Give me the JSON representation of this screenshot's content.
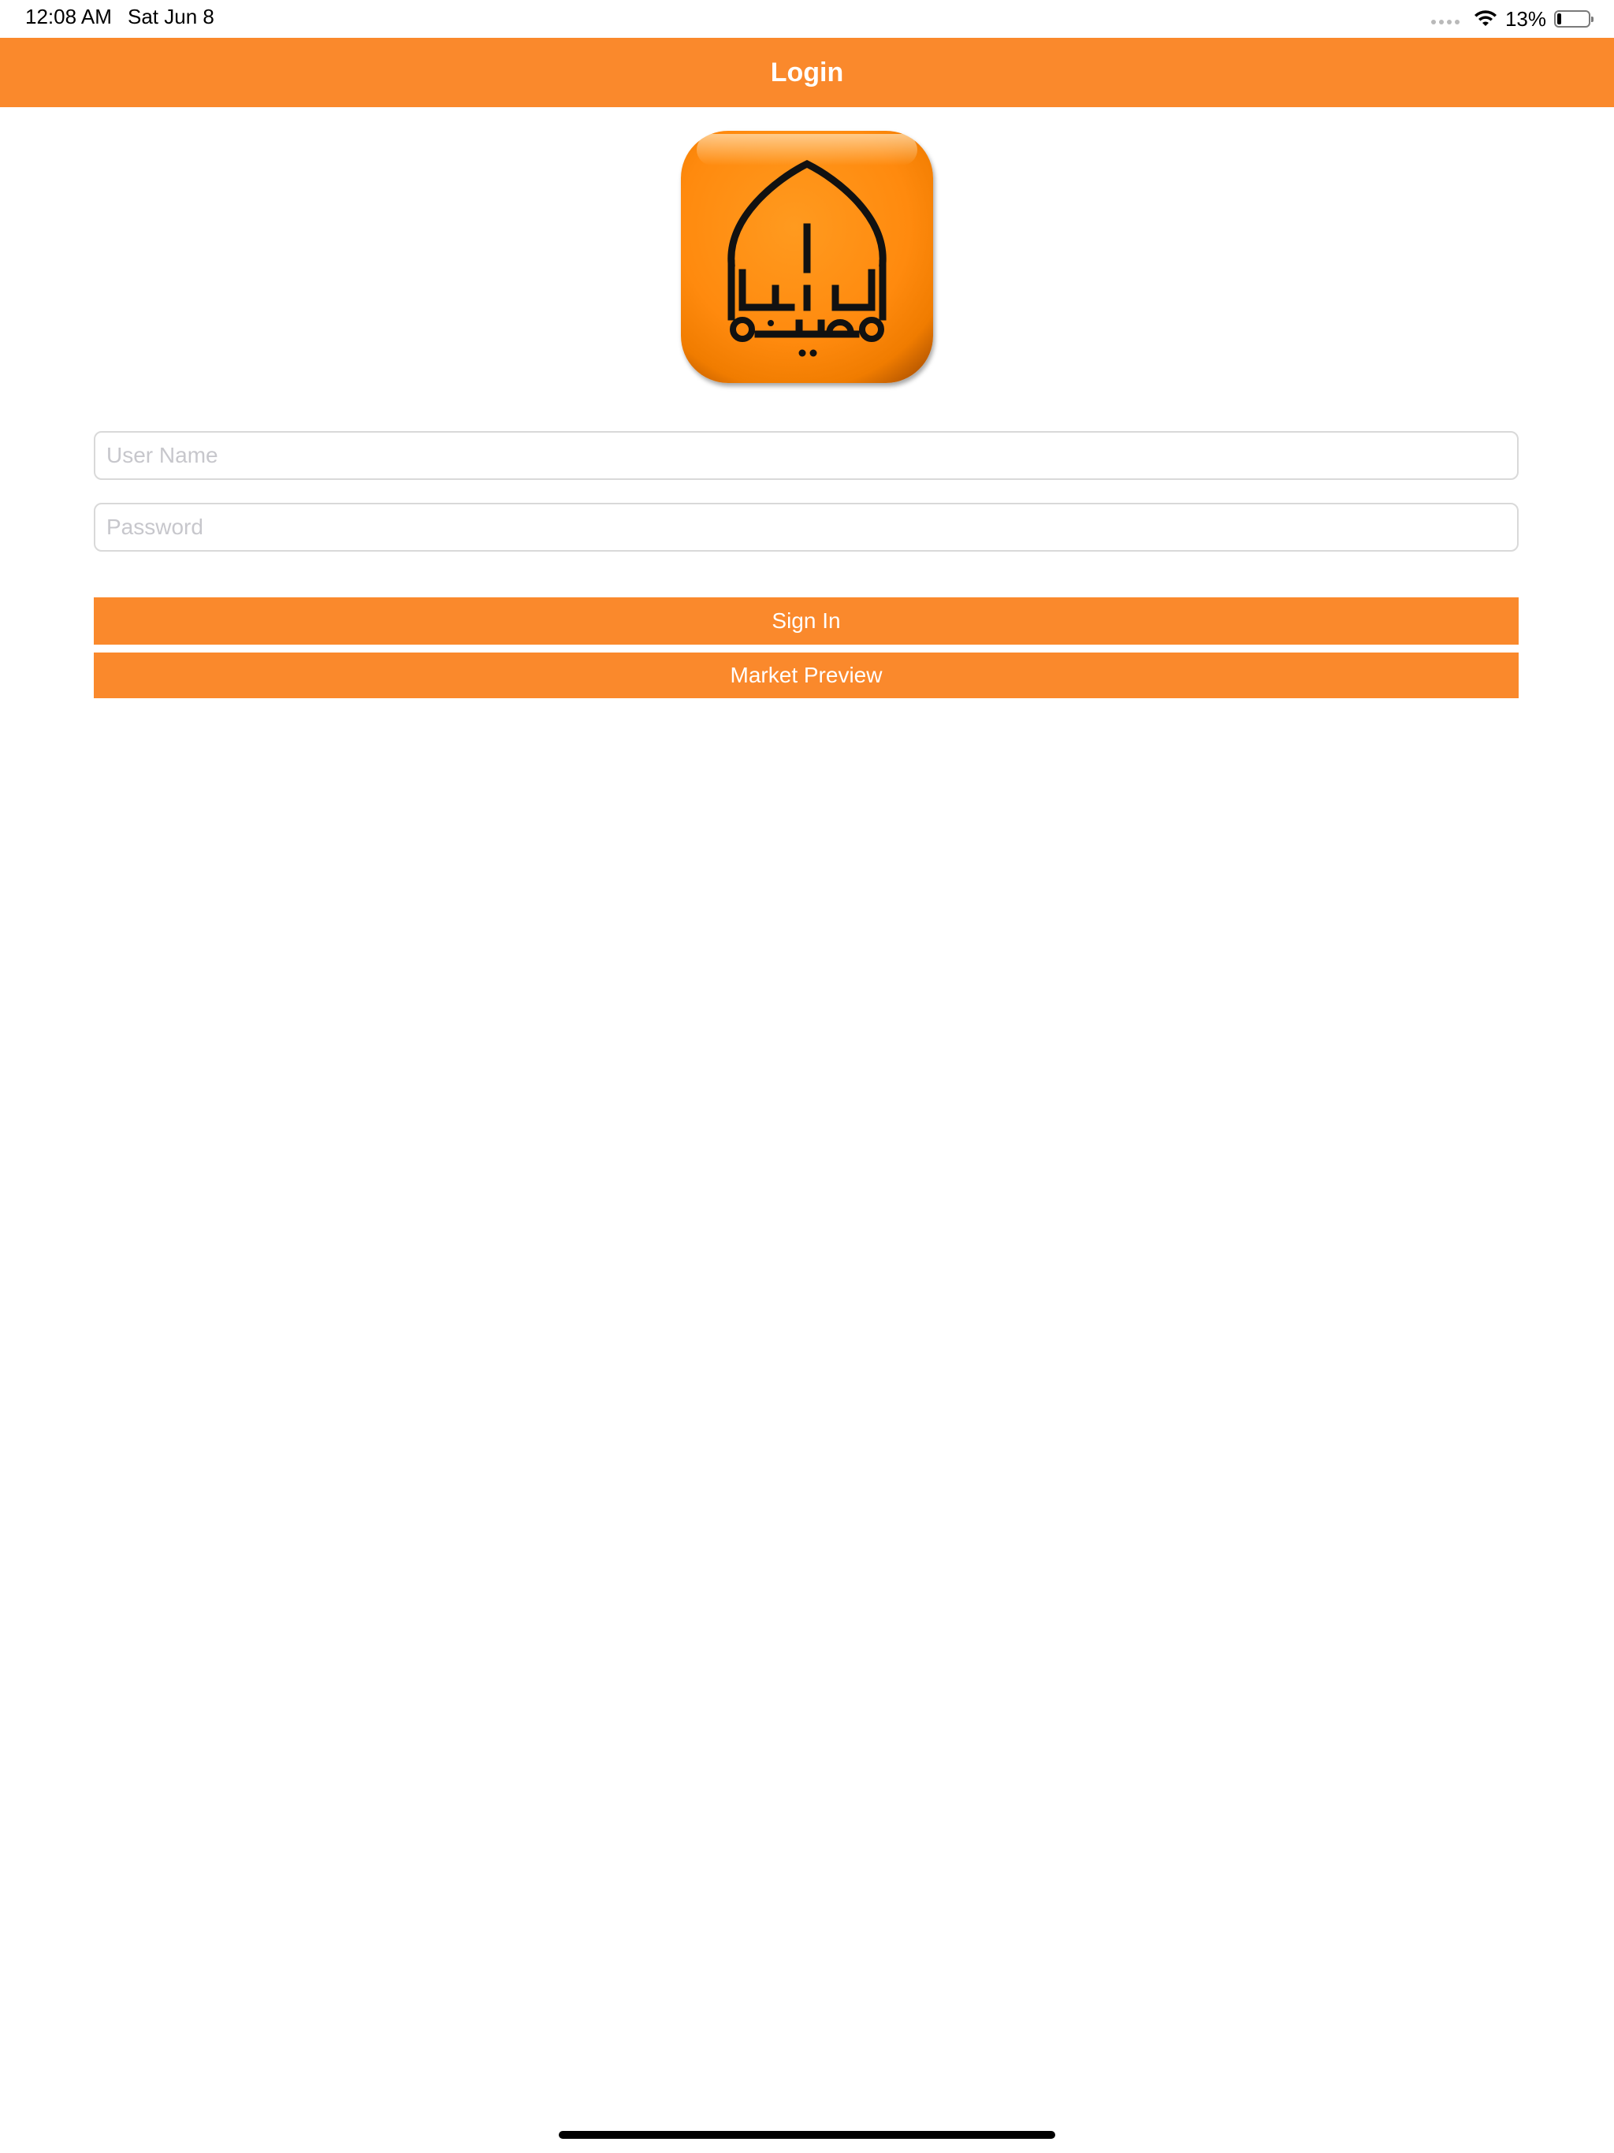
{
  "status_bar": {
    "time": "12:08 AM",
    "date": "Sat Jun 8",
    "battery_percent_label": "13%",
    "battery_level": 0.13,
    "icons": [
      "signal-dots-icon",
      "wifi-icon",
      "battery-icon"
    ]
  },
  "nav": {
    "title": "Login"
  },
  "logo": {
    "icon": "app-logo-icon"
  },
  "form": {
    "username_placeholder": "User Name",
    "username_value": "",
    "password_placeholder": "Password",
    "password_value": ""
  },
  "buttons": {
    "sign_in": "Sign In",
    "market_preview": "Market Preview"
  },
  "colors": {
    "accent": "#fa892c",
    "logo_orange": "#ff8a0e",
    "input_border": "#d9d9d9",
    "placeholder": "#c7c7cc"
  }
}
